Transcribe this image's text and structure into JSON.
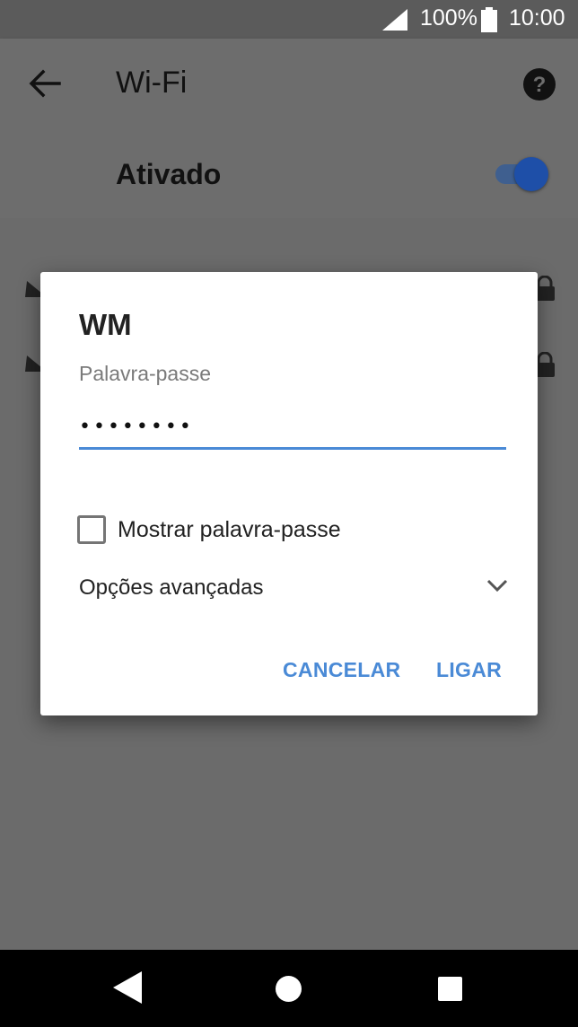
{
  "status": {
    "battery_pct": "100%",
    "time": "10:00"
  },
  "appbar": {
    "title": "Wi-Fi",
    "back_icon": "arrow-left-icon",
    "help_icon": "help-icon"
  },
  "wifi_toggle": {
    "label": "Ativado",
    "state": "on",
    "accent": "#1e4fa8"
  },
  "dialog": {
    "title": "WM",
    "password_label": "Palavra-passe",
    "password_value": "••••••••",
    "show_password_label": "Mostrar palavra-passe",
    "show_password_checked": false,
    "advanced_options_label": "Opções avançadas",
    "cancel_label": "CANCELAR",
    "connect_label": "LIGAR",
    "accent": "#4a8ad6"
  },
  "navbar": {
    "back_icon": "nav-back-icon",
    "home_icon": "nav-home-icon",
    "recent_icon": "nav-recents-icon"
  }
}
